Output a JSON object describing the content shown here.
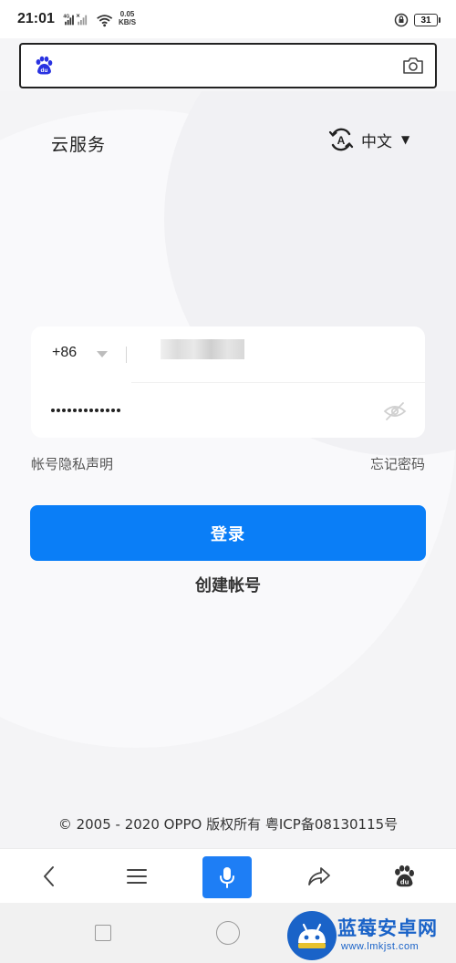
{
  "status_bar": {
    "time": "21:01",
    "network_label": "4G",
    "speed_value": "0.05",
    "speed_unit": "KB/S",
    "battery": "31"
  },
  "search": {
    "value": "",
    "placeholder": "",
    "logo_icon": "baidu-paw-icon",
    "camera_icon": "camera-icon"
  },
  "header": {
    "title": "云服务",
    "language_label": "中文",
    "language_icon": "language-icon"
  },
  "login_form": {
    "country_code": "+86",
    "phone_value": "",
    "password_dot_count": 13
  },
  "links": {
    "privacy": "帐号隐私声明",
    "forgot": "忘记密码"
  },
  "buttons": {
    "login": "登录",
    "create_account": "创建帐号"
  },
  "footer": {
    "copyright": "© 2005 - 2020 OPPO 版权所有 粤ICP备08130115号"
  },
  "toolbar": {
    "items": [
      "back-icon",
      "menu-icon",
      "microphone-icon",
      "share-icon",
      "baidu-paw-icon"
    ]
  },
  "watermark": {
    "title": "蓝莓安卓网",
    "url": "www.lmkjst.com"
  },
  "colors": {
    "primary": "#0a7ef7",
    "mic": "#1e7ef5",
    "baidu_blue": "#2932e1",
    "watermark": "#1a63c8"
  }
}
